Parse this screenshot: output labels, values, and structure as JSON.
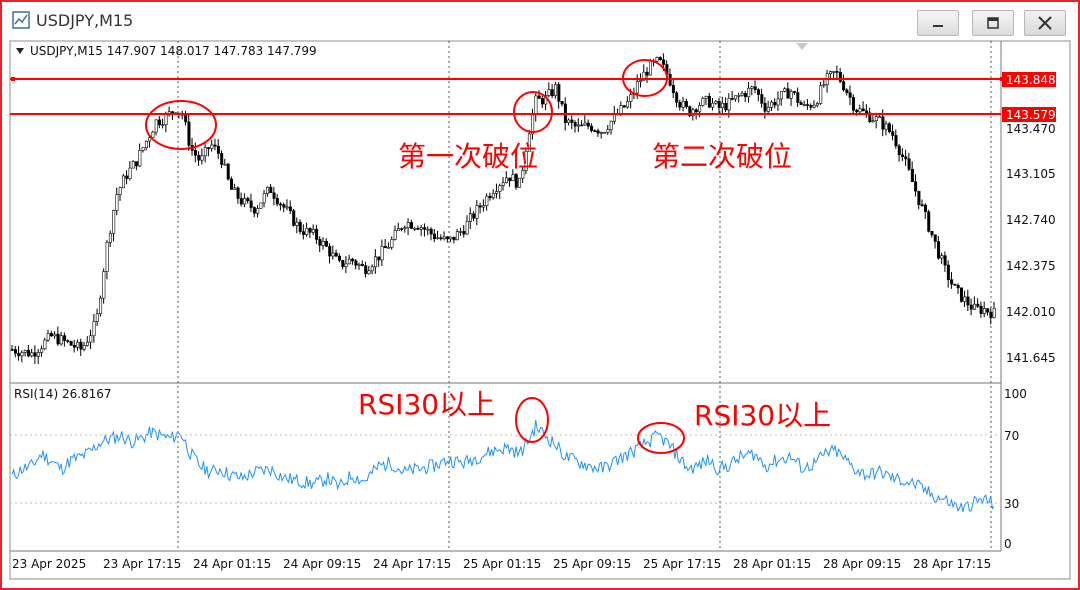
{
  "window": {
    "title": "USDJPY,M15",
    "buttons": [
      "minimize",
      "restore",
      "close"
    ]
  },
  "price_panel": {
    "header": "USDJPY,M15  147.907 148.017 147.783 147.799",
    "price_axis_labels": [
      "143.470",
      "143.105",
      "142.740",
      "142.375",
      "142.010",
      "141.645"
    ],
    "line_labels": [
      "143.848",
      "143.579"
    ],
    "annotations": [
      "第一次破位",
      "第二次破位"
    ]
  },
  "rsi_panel": {
    "header": "RSI(14) 26.8167",
    "axis_labels": [
      "100",
      "70",
      "30",
      "0"
    ],
    "annotations": [
      "RSI30以上",
      "RSI30以上"
    ]
  },
  "time_axis_labels": [
    "23 Apr 2025",
    "23 Apr 17:15",
    "24 Apr 01:15",
    "24 Apr 09:15",
    "24 Apr 17:15",
    "25 Apr 01:15",
    "25 Apr 09:15",
    "25 Apr 17:15",
    "28 Apr 01:15",
    "28 Apr 09:15",
    "28 Apr 17:15"
  ],
  "colors": {
    "frame": "#e8222a",
    "horizontal_lines": "#ff0000",
    "annotation_text": "#ff0000",
    "candles": "#000000",
    "rsi_line": "#1e90ff"
  },
  "chart_data": [
    {
      "type": "candlestick",
      "title": "USDJPY,M15",
      "ohlc_last": {
        "open": 147.907,
        "high": 148.017,
        "low": 147.783,
        "close": 147.799
      },
      "ylim": [
        141.5,
        144.05
      ],
      "y_ticks": [
        143.47,
        143.105,
        142.74,
        142.375,
        142.01,
        141.645
      ],
      "horizontal_lines": [
        143.848,
        143.579
      ],
      "close_path": [
        [
          0,
          141.75
        ],
        [
          20,
          141.72
        ],
        [
          40,
          141.85
        ],
        [
          55,
          141.8
        ],
        [
          70,
          141.75
        ],
        [
          85,
          141.95
        ],
        [
          95,
          142.5
        ],
        [
          105,
          142.9
        ],
        [
          115,
          143.05
        ],
        [
          125,
          143.15
        ],
        [
          135,
          143.3
        ],
        [
          145,
          143.45
        ],
        [
          155,
          143.48
        ],
        [
          165,
          143.55
        ],
        [
          172,
          143.5
        ],
        [
          180,
          143.25
        ],
        [
          190,
          143.15
        ],
        [
          200,
          143.28
        ],
        [
          210,
          143.2
        ],
        [
          220,
          142.95
        ],
        [
          232,
          142.85
        ],
        [
          245,
          142.8
        ],
        [
          260,
          142.95
        ],
        [
          275,
          142.8
        ],
        [
          290,
          142.65
        ],
        [
          305,
          142.6
        ],
        [
          318,
          142.5
        ],
        [
          330,
          142.38
        ],
        [
          342,
          142.42
        ],
        [
          355,
          142.35
        ],
        [
          370,
          142.45
        ],
        [
          382,
          142.55
        ],
        [
          395,
          142.7
        ],
        [
          410,
          142.68
        ],
        [
          425,
          142.6
        ],
        [
          440,
          142.55
        ],
        [
          455,
          142.65
        ],
        [
          470,
          142.8
        ],
        [
          485,
          142.95
        ],
        [
          500,
          143.05
        ],
        [
          512,
          142.98
        ],
        [
          520,
          143.35
        ],
        [
          528,
          143.6
        ],
        [
          538,
          143.62
        ],
        [
          548,
          143.7
        ],
        [
          558,
          143.45
        ],
        [
          570,
          143.4
        ],
        [
          582,
          143.42
        ],
        [
          595,
          143.38
        ],
        [
          610,
          143.5
        ],
        [
          622,
          143.6
        ],
        [
          632,
          143.75
        ],
        [
          642,
          143.85
        ],
        [
          652,
          143.9
        ],
        [
          662,
          143.78
        ],
        [
          672,
          143.6
        ],
        [
          682,
          143.52
        ],
        [
          692,
          143.58
        ],
        [
          702,
          143.6
        ],
        [
          712,
          143.55
        ],
        [
          722,
          143.58
        ],
        [
          735,
          143.65
        ],
        [
          748,
          143.7
        ],
        [
          760,
          143.55
        ],
        [
          772,
          143.62
        ],
        [
          785,
          143.68
        ],
        [
          798,
          143.55
        ],
        [
          810,
          143.6
        ],
        [
          820,
          143.75
        ],
        [
          830,
          143.82
        ],
        [
          840,
          143.7
        ],
        [
          850,
          143.55
        ],
        [
          862,
          143.5
        ],
        [
          875,
          143.45
        ],
        [
          888,
          143.35
        ],
        [
          900,
          143.15
        ],
        [
          910,
          142.95
        ],
        [
          920,
          142.75
        ],
        [
          930,
          142.55
        ],
        [
          940,
          142.35
        ],
        [
          950,
          142.2
        ],
        [
          960,
          142.12
        ],
        [
          970,
          142.05
        ],
        [
          980,
          142.05
        ],
        [
          990,
          142.02
        ]
      ]
    },
    {
      "type": "line",
      "title": "RSI(14)",
      "current_value": 26.8167,
      "ylim": [
        0,
        100
      ],
      "y_ticks": [
        100,
        70,
        30,
        0
      ],
      "levels": [
        70,
        30
      ],
      "points": [
        [
          0,
          45
        ],
        [
          10,
          50
        ],
        [
          20,
          52
        ],
        [
          30,
          60
        ],
        [
          40,
          55
        ],
        [
          50,
          50
        ],
        [
          60,
          56
        ],
        [
          70,
          58
        ],
        [
          80,
          62
        ],
        [
          90,
          68
        ],
        [
          100,
          70
        ],
        [
          110,
          72
        ],
        [
          120,
          68
        ],
        [
          130,
          70
        ],
        [
          140,
          74
        ],
        [
          150,
          72
        ],
        [
          160,
          70
        ],
        [
          170,
          74
        ],
        [
          180,
          60
        ],
        [
          190,
          52
        ],
        [
          200,
          48
        ],
        [
          210,
          50
        ],
        [
          220,
          46
        ],
        [
          232,
          44
        ],
        [
          245,
          48
        ],
        [
          260,
          50
        ],
        [
          275,
          44
        ],
        [
          290,
          42
        ],
        [
          305,
          40
        ],
        [
          318,
          44
        ],
        [
          330,
          38
        ],
        [
          342,
          46
        ],
        [
          355,
          42
        ],
        [
          370,
          52
        ],
        [
          382,
          54
        ],
        [
          395,
          48
        ],
        [
          410,
          50
        ],
        [
          425,
          52
        ],
        [
          440,
          56
        ],
        [
          455,
          54
        ],
        [
          470,
          58
        ],
        [
          485,
          62
        ],
        [
          500,
          64
        ],
        [
          512,
          60
        ],
        [
          520,
          68
        ],
        [
          528,
          78
        ],
        [
          538,
          72
        ],
        [
          548,
          66
        ],
        [
          558,
          58
        ],
        [
          570,
          55
        ],
        [
          582,
          52
        ],
        [
          595,
          50
        ],
        [
          610,
          56
        ],
        [
          622,
          60
        ],
        [
          632,
          64
        ],
        [
          642,
          68
        ],
        [
          652,
          72
        ],
        [
          662,
          66
        ],
        [
          672,
          58
        ],
        [
          682,
          50
        ],
        [
          692,
          52
        ],
        [
          702,
          56
        ],
        [
          712,
          50
        ],
        [
          722,
          52
        ],
        [
          735,
          58
        ],
        [
          748,
          60
        ],
        [
          760,
          52
        ],
        [
          772,
          56
        ],
        [
          785,
          58
        ],
        [
          798,
          50
        ],
        [
          810,
          54
        ],
        [
          820,
          60
        ],
        [
          830,
          62
        ],
        [
          840,
          56
        ],
        [
          850,
          50
        ],
        [
          862,
          46
        ],
        [
          875,
          48
        ],
        [
          888,
          44
        ],
        [
          900,
          42
        ],
        [
          910,
          40
        ],
        [
          920,
          36
        ],
        [
          930,
          32
        ],
        [
          940,
          30
        ],
        [
          950,
          26
        ],
        [
          960,
          24
        ],
        [
          970,
          28
        ],
        [
          980,
          30
        ],
        [
          990,
          27
        ]
      ]
    }
  ]
}
